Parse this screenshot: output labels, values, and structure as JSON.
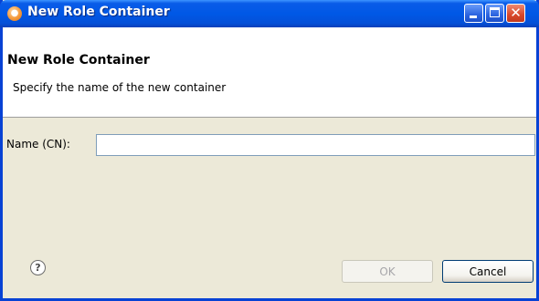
{
  "window": {
    "title": "New Role Container",
    "controls": {
      "minimize": "_",
      "maximize": "□",
      "close": "✕"
    }
  },
  "header": {
    "title": "New Role Container",
    "description": "Specify the name of the new container"
  },
  "form": {
    "name_label": "Name (CN):",
    "name_value": "",
    "name_placeholder": ""
  },
  "footer": {
    "help_glyph": "?",
    "ok_label": "OK",
    "ok_enabled": false,
    "cancel_label": "Cancel"
  },
  "colors": {
    "titlebar": "#0058e6",
    "dialog_background": "#ece9d8",
    "header_background": "#ffffff"
  }
}
